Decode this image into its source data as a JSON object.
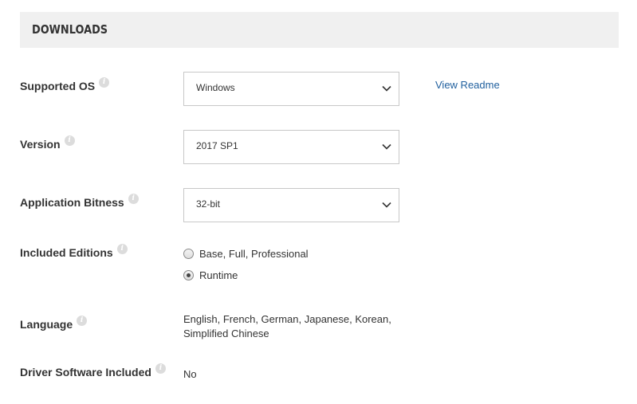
{
  "section": {
    "title": "DOWNLOADS"
  },
  "fields": {
    "supported_os": {
      "label": "Supported OS",
      "value": "Windows",
      "link": "View Readme"
    },
    "version": {
      "label": "Version",
      "value": "2017 SP1"
    },
    "bitness": {
      "label": "Application Bitness",
      "value": "32-bit"
    },
    "editions": {
      "label": "Included Editions",
      "options": [
        {
          "label": "Base, Full, Professional",
          "selected": false
        },
        {
          "label": "Runtime",
          "selected": true
        }
      ]
    },
    "language": {
      "label": "Language",
      "line1": "English, French, German, Japanese, Korean,",
      "line2": "Simplified Chinese"
    },
    "driver": {
      "label": "Driver Software Included",
      "value": "No"
    }
  },
  "icons": {
    "info": "info-icon",
    "dropdown": "chevron-down-icon"
  },
  "colors": {
    "header_bg": "#f0f0f0",
    "link": "#1f5f9e",
    "text": "#333333",
    "border": "#c8c8c8"
  }
}
